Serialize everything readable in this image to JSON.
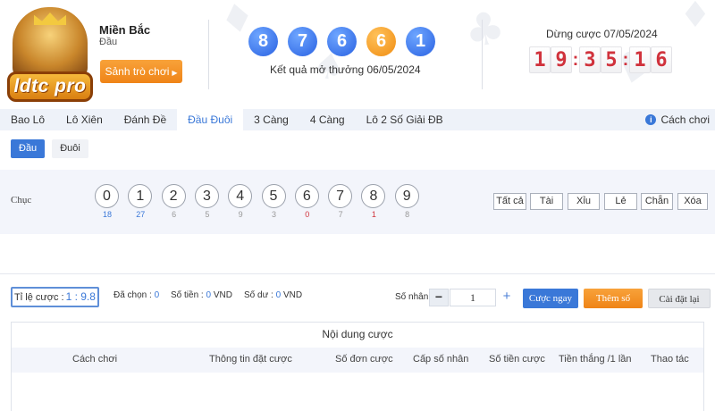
{
  "header": {
    "logo_text": "ldtc pro",
    "region_title": "Miền Bắc",
    "region_sub": "Đầu",
    "lobby_button": "Sảnh trò chơi",
    "result_numbers": [
      {
        "value": "8",
        "color": "#2a62e2"
      },
      {
        "value": "7",
        "color": "#2a62e2"
      },
      {
        "value": "6",
        "color": "#2a62e2"
      },
      {
        "value": "6",
        "color": "#f08d12"
      },
      {
        "value": "1",
        "color": "#2a62e2"
      }
    ],
    "result_label": "Kết quả mở thưởng 06/05/2024",
    "deadline_label": "Dừng cược 07/05/2024",
    "countdown": [
      "1",
      "9",
      "3",
      "5",
      "1",
      "6"
    ]
  },
  "tabs": [
    "Bao Lô",
    "Lô Xiên",
    "Đánh Đề",
    "Đầu Đuôi",
    "3 Càng",
    "4 Càng",
    "Lô 2 Số Giải ĐB"
  ],
  "active_tab": "Đầu Đuôi",
  "howto_label": "Cách chơi",
  "subtabs": [
    "Đầu",
    "Đuôi"
  ],
  "active_subtab": "Đầu",
  "row_label": "Chục",
  "numbers": [
    {
      "digit": "0",
      "count": "18",
      "count_color": "#3a78d8"
    },
    {
      "digit": "1",
      "count": "27",
      "count_color": "#3a78d8"
    },
    {
      "digit": "2",
      "count": "6",
      "count_color": "#999999"
    },
    {
      "digit": "3",
      "count": "5",
      "count_color": "#999999"
    },
    {
      "digit": "4",
      "count": "9",
      "count_color": "#999999"
    },
    {
      "digit": "5",
      "count": "3",
      "count_color": "#999999"
    },
    {
      "digit": "6",
      "count": "0",
      "count_color": "#d0323c"
    },
    {
      "digit": "7",
      "count": "7",
      "count_color": "#999999"
    },
    {
      "digit": "8",
      "count": "1",
      "count_color": "#d0323c"
    },
    {
      "digit": "9",
      "count": "8",
      "count_color": "#999999"
    }
  ],
  "quick_select": [
    "Tất cả",
    "Tài",
    "Xỉu",
    "Lẻ",
    "Chẵn",
    "Xóa"
  ],
  "action_bar": {
    "odds_label": "Tỉ lệ cược :",
    "odds_value": "1 : 9.8",
    "selected_label": "Đã chọn :",
    "selected_value": "0",
    "amount_label": "Số tiền :",
    "amount_value": "0",
    "amount_unit": "VND",
    "balance_label": "Số dư :",
    "balance_value": "0",
    "balance_unit": "VND",
    "multiplier_label": "Số nhân :",
    "multiplier_value": "1",
    "bet_now": "Cược ngay",
    "add_number": "Thêm số",
    "reset": "Cài đặt lại"
  },
  "bet_content": {
    "title": "Nội dung cược",
    "columns": [
      "Cách chơi",
      "Thông tin đặt cược",
      "Số đơn cược",
      "Cấp số nhân",
      "Số tiền cược",
      "Tiền thắng /1 lần",
      "Thao tác"
    ]
  },
  "colors": {
    "accent": "#3a78d8",
    "orange": "#ef8417",
    "countdown": "#d0323c"
  }
}
